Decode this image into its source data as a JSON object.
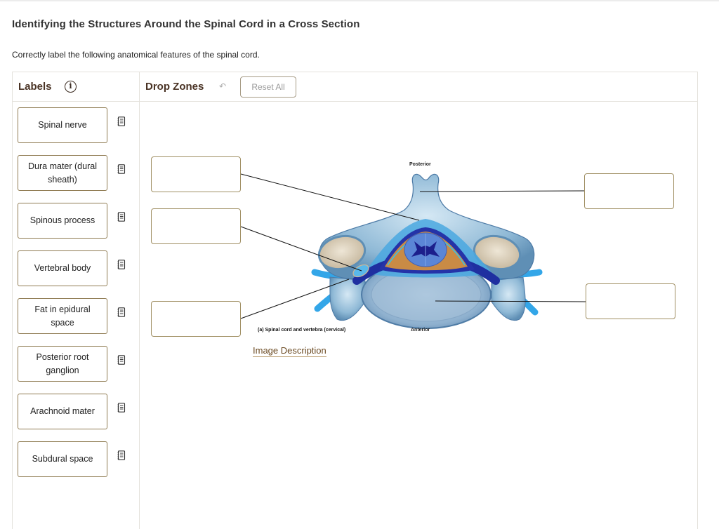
{
  "page": {
    "title": "Identifying the Structures Around the Spinal Cord in a Cross Section",
    "instructions": "Correctly label the following anatomical features of the spinal cord."
  },
  "labels_panel": {
    "heading": "Labels",
    "info_icon": "info-icon",
    "items": [
      {
        "label": "Spinal nerve",
        "icon": "notes-icon"
      },
      {
        "label": "Dura mater (dural sheath)",
        "icon": "notes-icon"
      },
      {
        "label": "Spinous process",
        "icon": "notes-icon"
      },
      {
        "label": "Vertebral body",
        "icon": "notes-icon"
      },
      {
        "label": "Fat in epidural space",
        "icon": "notes-icon"
      },
      {
        "label": "Posterior root ganglion",
        "icon": "notes-icon"
      },
      {
        "label": "Arachnoid mater",
        "icon": "notes-icon"
      },
      {
        "label": "Subdural space",
        "icon": "notes-icon"
      }
    ]
  },
  "drop_zones_panel": {
    "heading": "Drop Zones",
    "undo_icon": "undo-arrow-icon",
    "reset_label": "Reset All",
    "zones": [
      {
        "id": 1,
        "value": ""
      },
      {
        "id": 2,
        "value": ""
      },
      {
        "id": 3,
        "value": ""
      },
      {
        "id": 4,
        "value": ""
      },
      {
        "id": 5,
        "value": ""
      }
    ]
  },
  "figure": {
    "top_label": "Posterior",
    "bottom_label": "Anterior",
    "caption": "(a) Spinal cord and vertebra (cervical)",
    "image_description_link": "Image Description"
  },
  "colors": {
    "heading_brown": "#4a3325",
    "card_border": "#8f7b52",
    "link_brown": "#6b4a22",
    "bone_blue": "#9cc3dc",
    "nerve_blue": "#2a8fd8",
    "dura_dark": "#1f2fa0",
    "fat_orange": "#c98b45"
  }
}
